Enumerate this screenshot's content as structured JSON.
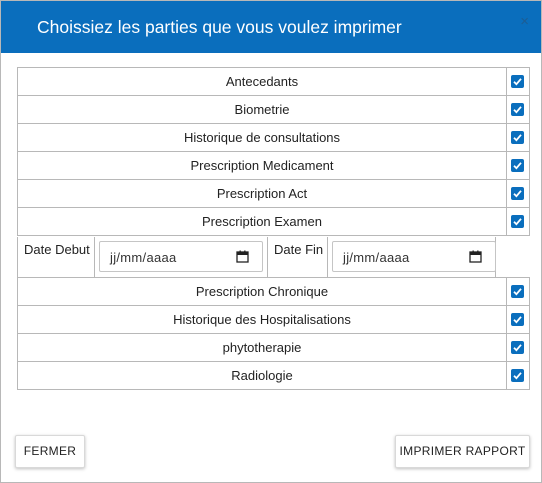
{
  "dialog": {
    "title": "Choissiez les parties que vous voulez imprimer",
    "close_glyph": "×"
  },
  "sections_top": [
    {
      "label": "Antecedants",
      "checked": true
    },
    {
      "label": "Biometrie",
      "checked": true
    },
    {
      "label": "Historique de consultations",
      "checked": true
    },
    {
      "label": "Prescription Medicament",
      "checked": true
    },
    {
      "label": "Prescription Act",
      "checked": true
    },
    {
      "label": "Prescription Examen",
      "checked": true
    }
  ],
  "dates": {
    "start_label": "Date Debut",
    "start_value": "jj/mm/aaaa",
    "end_label": "Date Fin",
    "end_value": "jj/mm/aaaa"
  },
  "sections_bottom": [
    {
      "label": "Prescription Chronique",
      "checked": true
    },
    {
      "label": "Historique des Hospitalisations",
      "checked": true
    },
    {
      "label": "phytotherapie",
      "checked": true
    },
    {
      "label": "Radiologie",
      "checked": true
    }
  ],
  "buttons": {
    "close_label": "FERMER",
    "print_label": "IMPRIMER RAPPORT"
  },
  "colors": {
    "header": "#0a6ebd",
    "checkbox": "#0a6ebd"
  },
  "icons": {
    "close": "close-icon",
    "checkbox": "checkbox-checked-icon",
    "calendar": "calendar-icon"
  }
}
